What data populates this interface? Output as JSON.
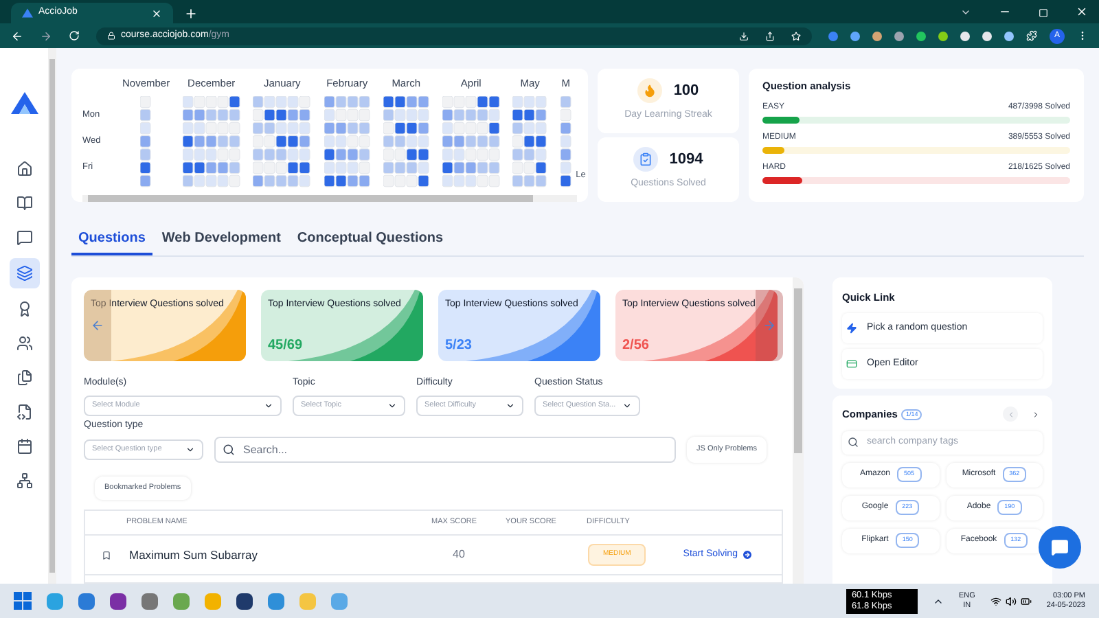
{
  "browser": {
    "tab_title": "AccioJob",
    "url_host": "course.acciojob.com",
    "url_path": "/gym",
    "profile": "A"
  },
  "heatmap": {
    "months": [
      {
        "label": "November"
      },
      {
        "label": "December"
      },
      {
        "label": "January"
      },
      {
        "label": "February"
      },
      {
        "label": "March"
      },
      {
        "label": "April"
      },
      {
        "label": "May"
      },
      {
        "label": "M"
      }
    ],
    "days": [
      "Mon",
      "Wed",
      "Fri"
    ],
    "legend": "Le"
  },
  "streak": {
    "value": "100",
    "label": "Day Learning Streak"
  },
  "solved": {
    "value": "1094",
    "label": "Questions Solved"
  },
  "analysis": {
    "title": "Question analysis",
    "rows": [
      {
        "label": "EASY",
        "reading": "487/3998 Solved",
        "level": 0.12,
        "color": "#16a34a"
      },
      {
        "label": "MEDIUM",
        "reading": "389/5553 Solved",
        "level": 0.07,
        "color": "#eab308"
      },
      {
        "label": "HARD",
        "reading": "218/1625 Solved",
        "level": 0.13,
        "color": "#dc2626"
      }
    ]
  },
  "tabs": [
    {
      "label": "Questions",
      "selected": true
    },
    {
      "label": "Web Development",
      "selected": false
    },
    {
      "label": "Conceptual Questions",
      "selected": false
    }
  ],
  "cards": [
    {
      "title": "Top Interview Questions solved",
      "color": "#f59e0b"
    },
    {
      "title": "Top Interview Questions solved",
      "count": "45/69",
      "color": "#22a861"
    },
    {
      "title": "Top Interview Questions solved",
      "count": "5/23",
      "color": "#3b82f6"
    },
    {
      "title": "Top Interview Questions solved",
      "count": "2/56",
      "color": "#ef5350"
    }
  ],
  "filters": [
    {
      "label": "Module(s)",
      "placeholder": "Select Module"
    },
    {
      "label": "Topic",
      "placeholder": "Select Topic"
    },
    {
      "label": "Difficulty",
      "placeholder": "Select Difficulty"
    },
    {
      "label": "Question Status",
      "placeholder": "Select Question Sta..."
    }
  ],
  "question_type": {
    "label": "Question type",
    "placeholder": "Select Question type"
  },
  "search": {
    "placeholder": "Search..."
  },
  "buttons": [
    "JS Only Problems",
    "Bookmarked Problems"
  ],
  "table": {
    "columns": [
      "PROBLEM NAME",
      "MAX SCORE",
      "YOUR SCORE",
      "DIFFICULTY"
    ],
    "rows": [
      {
        "name": "Maximum Sum Subarray",
        "max_score": "40",
        "difficulty": "MEDIUM",
        "action": "Start Solving",
        "bookmarked": false
      }
    ]
  },
  "quick_link": {
    "title": "Quick Link",
    "items": [
      "Pick a random question",
      "Open Editor"
    ]
  },
  "companies": {
    "title": "Companies",
    "page": "1/14",
    "placeholder": "search company tags",
    "tags": [
      {
        "name": "Amazon",
        "count": "505"
      },
      {
        "name": "Microsoft",
        "count": "362"
      },
      {
        "name": "Google",
        "count": "223"
      },
      {
        "name": "Adobe",
        "count": "190"
      },
      {
        "name": "Flipkart",
        "count": "150"
      },
      {
        "name": "Facebook",
        "count": "132"
      }
    ]
  },
  "taskbar": {
    "net_up": "60.1 Kbps",
    "net_down": "61.8 Kbps",
    "lang": "ENG",
    "region": "IN",
    "time": "03:00 PM",
    "date": "24-05-2023"
  }
}
